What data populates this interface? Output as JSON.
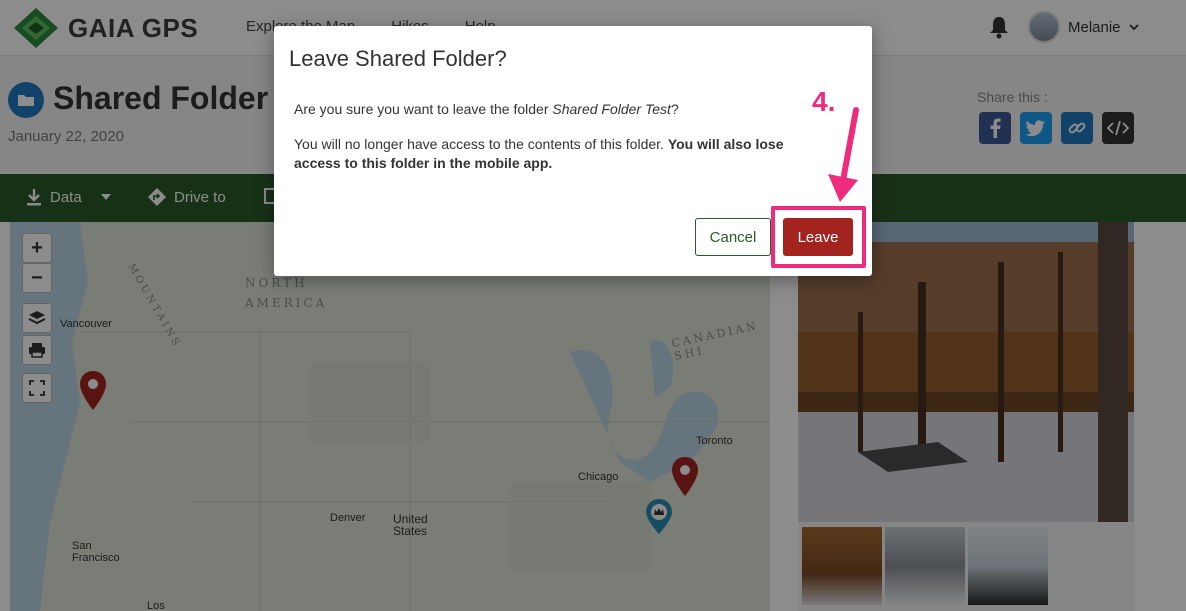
{
  "header": {
    "brand": "GAIA GPS",
    "nav": [
      "Explore the Map",
      "Hikes",
      "Help"
    ],
    "user_name": "Melanie"
  },
  "folder": {
    "title": "Shared Folder T",
    "date": "January 22, 2020",
    "share_label": "Share this :",
    "share_icons": [
      "facebook-icon",
      "twitter-icon",
      "link-icon",
      "embed-icon"
    ]
  },
  "toolbar": {
    "items": [
      "Data",
      "Drive to"
    ]
  },
  "map": {
    "regions": [
      "NORTH",
      "AMERICA",
      "MOUNTAINS",
      "CANADIAN SHI"
    ],
    "cities": [
      "Vancouver",
      "Toronto",
      "Chicago",
      "Denver",
      "United",
      "States",
      "San",
      "Francisco",
      "Los"
    ],
    "zoom_in": "+",
    "zoom_out": "−"
  },
  "modal": {
    "title": "Leave Shared Folder?",
    "line1_prefix": "Are you sure you want to leave the folder ",
    "line1_folder": "Shared Folder Test",
    "line1_suffix": "?",
    "line2_plain": "You will no longer have access to the contents of this folder. ",
    "line2_bold": "You will also lose access to this folder in the mobile app.",
    "cancel_label": "Cancel",
    "leave_label": "Leave"
  },
  "annotation": {
    "step": "4."
  },
  "colors": {
    "toolbar_green": "#2b5a2a",
    "leave_red": "#a3231e",
    "annotation_pink": "#ee2b7c",
    "folder_blue": "#1f7bc1"
  }
}
